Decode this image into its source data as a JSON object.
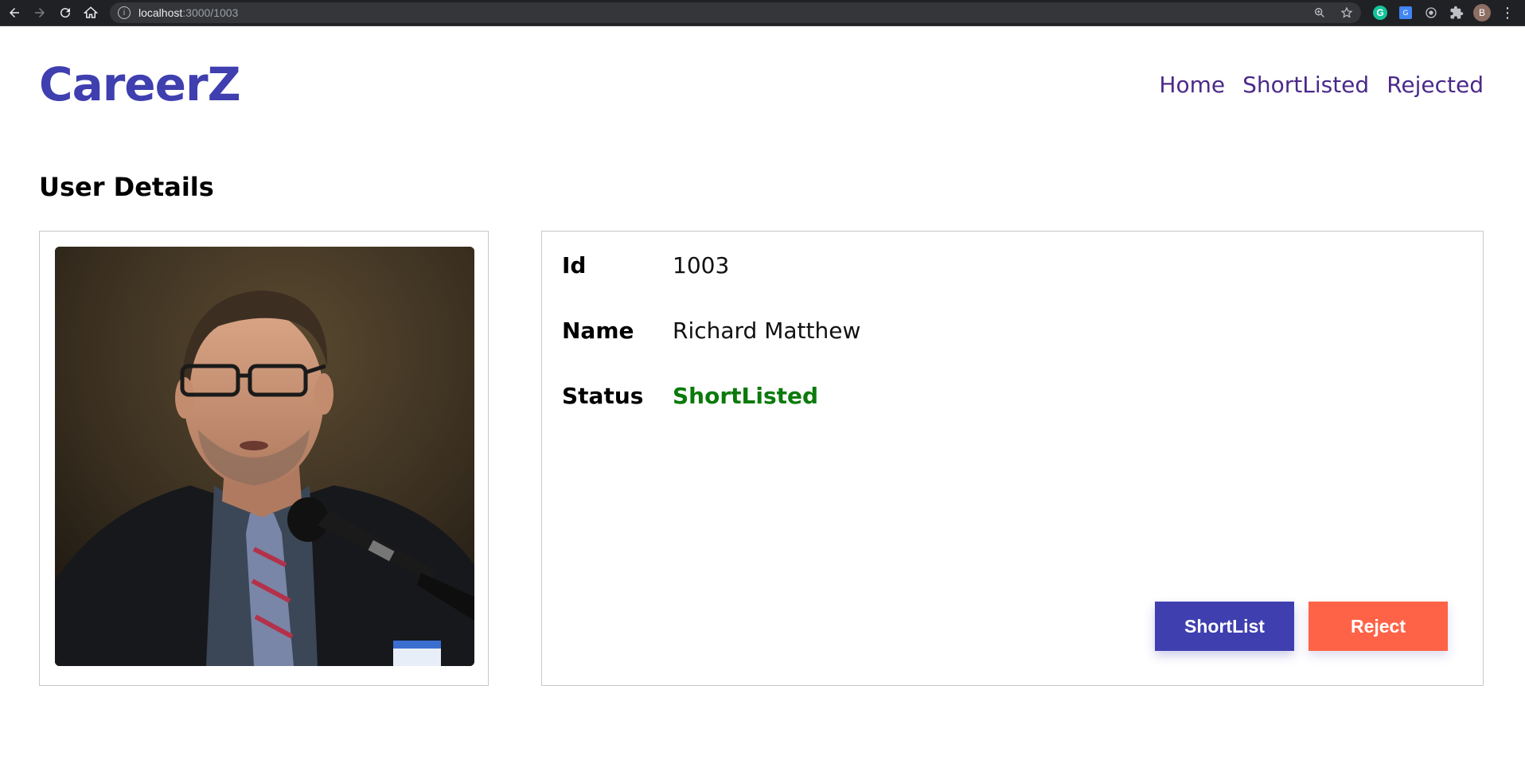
{
  "browser": {
    "url_host": "localhost",
    "url_path": ":3000/1003",
    "profile_initial": "B",
    "grammarly_letter": "G"
  },
  "header": {
    "brand": "CareerZ",
    "nav": [
      "Home",
      "ShortListed",
      "Rejected"
    ]
  },
  "page": {
    "title": "User Details"
  },
  "user": {
    "id_label": "Id",
    "id": "1003",
    "name_label": "Name",
    "name": "Richard Matthew",
    "status_label": "Status",
    "status": "ShortListed",
    "status_color": "#0b7a0b"
  },
  "actions": {
    "shortlist_label": "ShortList",
    "reject_label": "Reject",
    "shortlist_color": "#3f3fb0",
    "reject_color": "#ff6347"
  },
  "theme": {
    "brand_color": "#3f3fb0",
    "nav_color": "#4b2a8a"
  }
}
